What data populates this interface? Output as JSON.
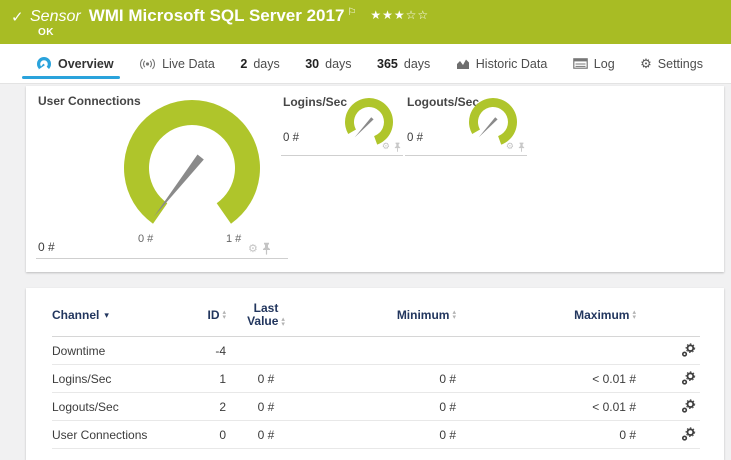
{
  "colors": {
    "header_green": "#a8bc24",
    "gauge_green": "#afc52b",
    "accent_blue": "#2aa3dc",
    "table_header_text": "#22365e"
  },
  "icons": {
    "check": "✓",
    "flag": "⚐",
    "gear": "⚙",
    "sort_up": "▴",
    "sort_down": "▾",
    "channel_sort_arrow": "▾"
  },
  "header": {
    "kind_label": "Sensor",
    "title": "WMI Microsoft SQL Server 2017",
    "rating_filled": "★★★",
    "rating_empty": "☆☆",
    "status": "OK"
  },
  "tabs": [
    {
      "label": "Overview",
      "icon": "gauge-icon",
      "active": true
    },
    {
      "label": "Live Data",
      "icon": "broadcast-icon"
    },
    {
      "prefix": "2",
      "label": "days"
    },
    {
      "prefix": "30",
      "label": "days"
    },
    {
      "prefix": "365",
      "label": "days"
    },
    {
      "label": "Historic Data",
      "icon": "area-chart-icon"
    },
    {
      "label": "Log",
      "icon": "log-icon"
    },
    {
      "label": "Settings",
      "icon": "gear-icon"
    }
  ],
  "gauges": {
    "primary": {
      "title": "User Connections",
      "current_value": "0 #",
      "scale_min": "0 #",
      "scale_max": "1 #"
    },
    "secondary": [
      {
        "title": "Logins/Sec",
        "current_value": "0 #"
      },
      {
        "title": "Logouts/Sec",
        "current_value": "0 #"
      }
    ]
  },
  "chart_data": [
    {
      "type": "gauge",
      "title": "User Connections",
      "value": 0,
      "unit": "#",
      "min": 0,
      "max": 1
    },
    {
      "type": "gauge",
      "title": "Logins/Sec",
      "value": 0,
      "unit": "#"
    },
    {
      "type": "gauge",
      "title": "Logouts/Sec",
      "value": 0,
      "unit": "#"
    }
  ],
  "table": {
    "headers": {
      "channel": "Channel",
      "id": "ID",
      "last_line1": "Last",
      "last_line2": "Value",
      "minimum": "Minimum",
      "maximum": "Maximum"
    },
    "rows": [
      {
        "channel": "Downtime",
        "id": "-4",
        "last": "",
        "min": "",
        "max": ""
      },
      {
        "channel": "Logins/Sec",
        "id": "1",
        "last": "0 #",
        "min": "0 #",
        "max": "< 0.01 #"
      },
      {
        "channel": "Logouts/Sec",
        "id": "2",
        "last": "0 #",
        "min": "0 #",
        "max": "< 0.01 #"
      },
      {
        "channel": "User Connections",
        "id": "0",
        "last": "0 #",
        "min": "0 #",
        "max": "0 #"
      }
    ]
  }
}
